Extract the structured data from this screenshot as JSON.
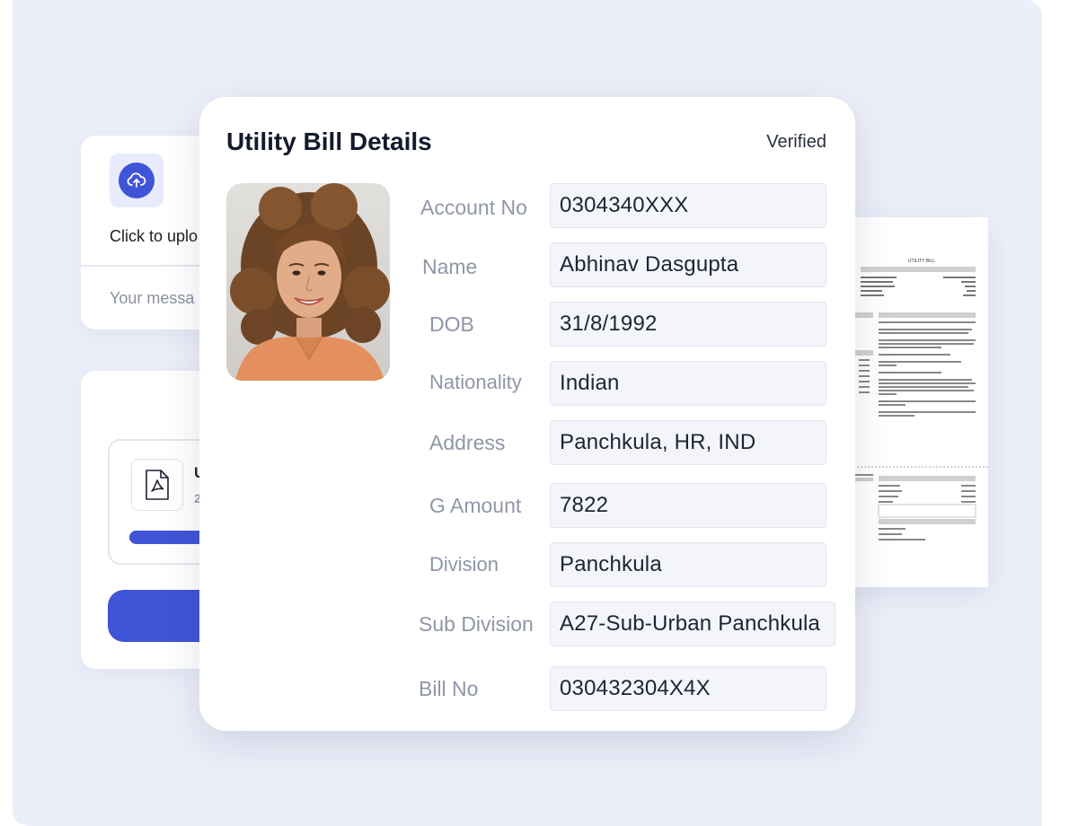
{
  "upload": {
    "prompt_label": "Click to uplo",
    "message_placeholder": "Your messa"
  },
  "file": {
    "name_fragment": "U",
    "size_fragment": "2",
    "icon": "pdf-file-icon",
    "progress": 1.0
  },
  "card": {
    "title": "Utility Bill Details",
    "status": "Verified",
    "photo_icon": "person-photo",
    "fields": [
      {
        "label": "Account No",
        "value": "0304340XXX"
      },
      {
        "label": "Name",
        "value": "Abhinav Dasgupta"
      },
      {
        "label": "DOB",
        "value": "31/8/1992"
      },
      {
        "label": "Nationality",
        "value": "Indian"
      },
      {
        "label": "Address",
        "value": "Panchkula, HR, IND"
      },
      {
        "label": "G Amount",
        "value": "7822"
      },
      {
        "label": "Division",
        "value": "Panchkula"
      },
      {
        "label": "Sub Division",
        "value": "A27-Sub-Urban Panchkula"
      },
      {
        "label": "Bill No",
        "value": "030432304X4X"
      }
    ]
  },
  "document": {
    "heading": "UTILITY BILL",
    "icon": "bill-document-preview"
  },
  "colors": {
    "accent": "#3f54d6",
    "background": "#eceff9",
    "field_bg": "#f3f5fb",
    "label": "#9096a6"
  }
}
